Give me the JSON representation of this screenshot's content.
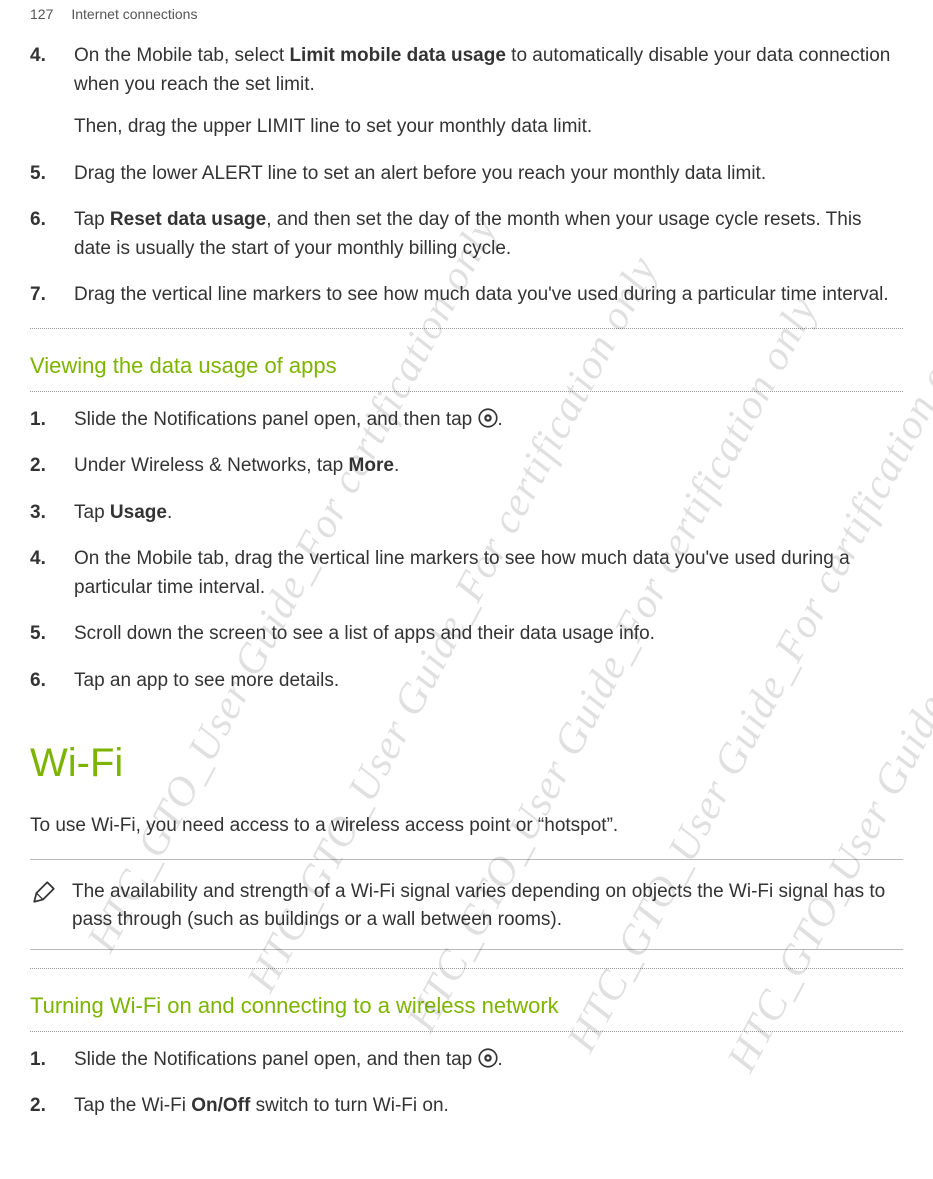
{
  "header": {
    "page_number": "127",
    "section": "Internet connections"
  },
  "steps_top": [
    {
      "n": "4",
      "prefix": "On the Mobile tab, select ",
      "bold": "Limit mobile data usage",
      "suffix": " to automatically disable your data connection when you reach the set limit.",
      "extra": "Then, drag the upper LIMIT line to set your monthly data limit."
    },
    {
      "n": "5",
      "text": "Drag the lower ALERT line to set an alert before you reach your monthly data limit."
    },
    {
      "n": "6",
      "prefix": "Tap ",
      "bold": "Reset data usage",
      "suffix": ", and then set the day of the month when your usage cycle resets. This date is usually the start of your monthly billing cycle."
    },
    {
      "n": "7",
      "text": "Drag the vertical line markers to see how much data you've used during a particular time interval."
    }
  ],
  "subhead_apps": "Viewing the data usage of apps",
  "steps_apps": [
    {
      "n": "1",
      "prefix": "Slide the Notifications panel open, and then tap ",
      "icon": "gear",
      "suffix": "."
    },
    {
      "n": "2",
      "prefix": "Under Wireless & Networks, tap ",
      "bold": "More",
      "suffix": "."
    },
    {
      "n": "3",
      "prefix": "Tap ",
      "bold": "Usage",
      "suffix": "."
    },
    {
      "n": "4",
      "text": "On the Mobile tab, drag the vertical line markers to see how much data you've used during a particular time interval."
    },
    {
      "n": "5",
      "text": "Scroll down the screen to see a list of apps and their data usage info."
    },
    {
      "n": "6",
      "text": "Tap an app to see more details."
    }
  ],
  "wifi": {
    "title": "Wi-Fi",
    "intro": "To use Wi-Fi, you need access to a wireless access point or “hotspot”.",
    "note": "The availability and strength of a Wi-Fi signal varies depending on objects the Wi-Fi signal has to pass through (such as buildings or a wall between rooms).",
    "subhead": "Turning Wi-Fi on and connecting to a wireless network",
    "steps": [
      {
        "n": "1",
        "prefix": "Slide the Notifications panel open, and then tap ",
        "icon": "gear",
        "suffix": "."
      },
      {
        "n": "2",
        "prefix": "Tap the Wi-Fi ",
        "bold": "On/Off",
        "suffix": " switch to turn Wi-Fi on."
      }
    ]
  },
  "watermark": "HTC_GTO_User Guide_For certification only"
}
